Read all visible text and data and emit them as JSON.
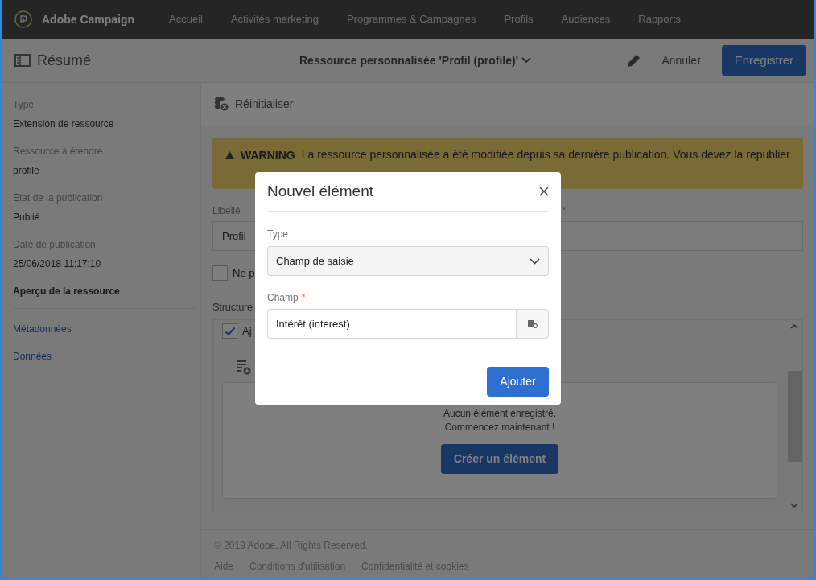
{
  "top_nav": {
    "brand": "Adobe Campaign",
    "items": [
      {
        "label": "Accueil",
        "selected": false
      },
      {
        "label": "Activités marketing",
        "selected": false
      },
      {
        "label": "Programmes & Campagnes",
        "selected": false
      },
      {
        "label": "Profils",
        "selected": false
      },
      {
        "label": "Audiences",
        "selected": false
      },
      {
        "label": "Rapports",
        "selected": false
      }
    ]
  },
  "toolbar": {
    "title": "Résumé",
    "resource_title": "Ressource personnalisée 'Profil (profile)'",
    "cancel": "Annuler",
    "save": "Enregistrer"
  },
  "sidebar": {
    "fields": [
      {
        "label": "Type",
        "value": "Extension de ressource"
      },
      {
        "label": "Ressource à étendre",
        "value": "profile"
      },
      {
        "label": "Etat de la publication",
        "value": "Publié"
      },
      {
        "label": "Date de publication",
        "value": "25/06/2018 11:17:10"
      }
    ],
    "section": "Aperçu de la ressource",
    "links": [
      "Métadonnées",
      "Données"
    ]
  },
  "main": {
    "reset": "Réinitialiser",
    "warning": {
      "label": "WARNING",
      "text": "La ressource personnalisée a été modifiée depuis sa dernière publication. Vous devez la republier"
    },
    "label_field": {
      "label": "Libellé",
      "value": "Profil",
      "second_required_mark": "*"
    },
    "checkbox": {
      "label": "Ne p",
      "checked": false
    },
    "structure": {
      "title": "Structure",
      "checkbox": {
        "label": "Aj",
        "checked": true
      },
      "empty_line_1": "Aucun élément enregistré.",
      "empty_line_2": "Commencez maintenant !",
      "create": "Créer un élément"
    }
  },
  "footer": {
    "copyright": "© 2019 Adobe. All Rights Reserved.",
    "links": [
      "Aide",
      "Conditions d'utilisation",
      "Confidentialité et cookies"
    ]
  },
  "dialog": {
    "title": "Nouvel élément",
    "type_label": "Type",
    "type_value": "Champ de saisie",
    "field_label": "Champ",
    "required_mark": "*",
    "field_value": "Intérêt (interest)",
    "add": "Ajouter"
  }
}
